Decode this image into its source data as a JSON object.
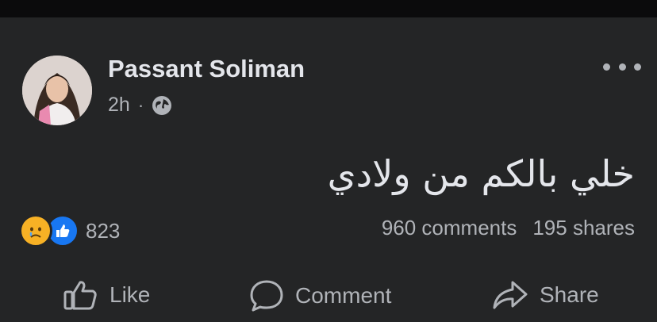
{
  "post": {
    "author": "Passant Soliman",
    "time": "2h",
    "separator": "·",
    "privacy_icon": "globe-icon",
    "body": "خلي بالكم من ولادي",
    "reaction_count": "823",
    "comments": "960 comments",
    "shares": "195 shares"
  },
  "actions": {
    "like": "Like",
    "comment": "Comment",
    "share": "Share"
  },
  "colors": {
    "background": "#242526",
    "text": "#e4e6eb",
    "secondary": "#b0b3b8",
    "like_blue": "#1877f2",
    "sad_yellow": "#f7b125"
  }
}
